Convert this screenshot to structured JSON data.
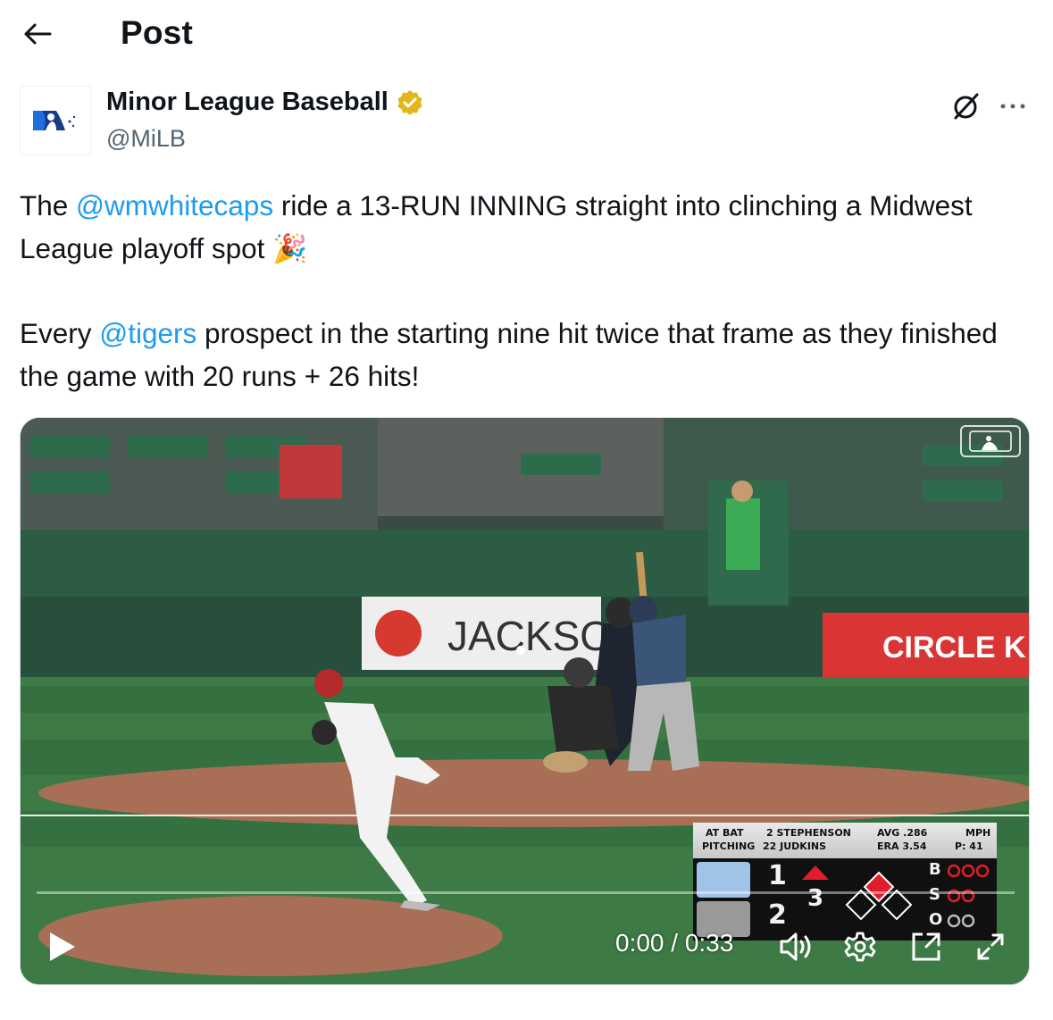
{
  "header": {
    "title": "Post",
    "back_icon": "arrow-left-icon"
  },
  "author": {
    "name": "Minor League Baseball",
    "handle": "@MiLB",
    "verified_badge": "gold-verified-badge-icon",
    "avatar": "milb-logo"
  },
  "tweet": {
    "para1_pre": "The ",
    "mention1": "@wmwhitecaps",
    "para1_post": " ride a 13-RUN INNING straight into clinching a Midwest League playoff spot ",
    "emoji1": "🎉",
    "para2_pre": "Every ",
    "mention2": "@tigers",
    "para2_post": " prospect in the starting nine hit twice that frame as they finished the game with 20 runs + 26 hits!"
  },
  "video": {
    "current_time": "0:00",
    "duration": "0:33",
    "time_display": "0:00 / 0:33",
    "progress": 0,
    "ad_banner_left": "JACKSO",
    "ad_banner_right": "CIRCLE K",
    "scorebug": {
      "at_bat_label": "AT BAT",
      "pitching_label": "PITCHING",
      "batter": "2 STEPHENSON",
      "pitcher": "22 JUDKINS",
      "avg": "AVG .286",
      "era": "ERA 3.54",
      "mph_label": "MPH",
      "pitch_count": "P: 41",
      "away_score": "1",
      "home_score": "2",
      "inning": "3",
      "balls_label": "B",
      "strikes_label": "S",
      "outs_label": "O"
    }
  },
  "colors": {
    "accent": "#1d9bf0",
    "text": "#0f1419",
    "secondary": "#536471",
    "verified": "#e2b719"
  }
}
